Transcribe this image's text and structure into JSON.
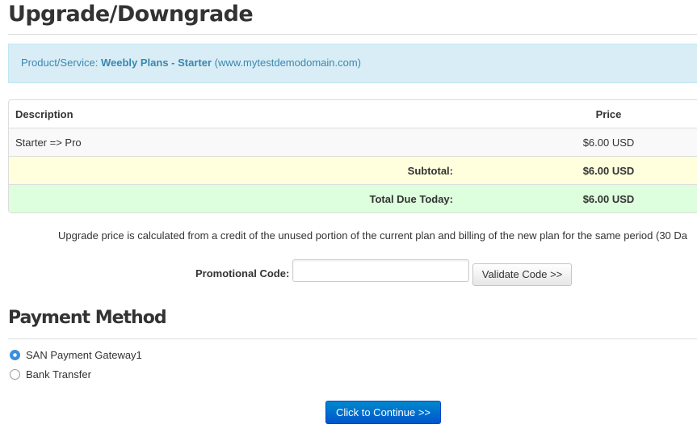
{
  "page": {
    "title": "Upgrade/Downgrade"
  },
  "info": {
    "label": "Product/Service:",
    "product": "Weebly Plans - Starter",
    "domain": "(www.mytestdemodomain.com)"
  },
  "table": {
    "headers": {
      "description": "Description",
      "price": "Price"
    },
    "item": {
      "description": "Starter => Pro",
      "price": "$6.00 USD"
    },
    "subtotal": {
      "label": "Subtotal:",
      "value": "$6.00 USD"
    },
    "total": {
      "label": "Total Due Today:",
      "value": "$6.00 USD"
    }
  },
  "note": "Upgrade price is calculated from a credit of the unused portion of the current plan and billing of the new plan for the same period (30 Da",
  "promo": {
    "label": "Promotional Code:",
    "value": "",
    "button": "Validate Code >>"
  },
  "payment": {
    "title": "Payment Method",
    "options": [
      {
        "label": "SAN Payment Gateway1",
        "checked": true
      },
      {
        "label": "Bank Transfer",
        "checked": false
      }
    ]
  },
  "continue_button": "Click to Continue >>",
  "colors": {
    "info_bg": "#d9edf7",
    "subtotal_bg": "#ffffdd",
    "total_bg": "#ddffdd",
    "primary": "#0066cc"
  }
}
